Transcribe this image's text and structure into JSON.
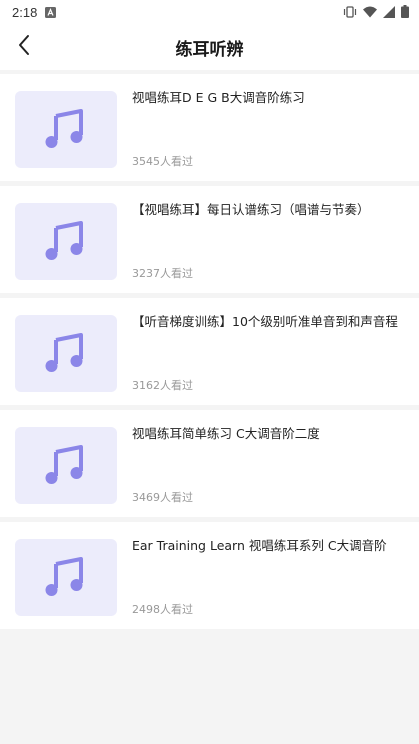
{
  "status_bar": {
    "time": "2:18"
  },
  "header": {
    "title": "练耳听辨"
  },
  "colors": {
    "thumb_bg": "#ececfb",
    "note_icon": "#8b86e8"
  },
  "items": [
    {
      "title": "视唱练耳D E G B大调音阶练习",
      "views": "3545人看过",
      "icon": "music-note-icon"
    },
    {
      "title": "【视唱练耳】每日认谱练习（唱谱与节奏）",
      "views": "3237人看过",
      "icon": "music-note-icon"
    },
    {
      "title": "【听音梯度训练】10个级别听准单音到和声音程",
      "views": "3162人看过",
      "icon": "music-note-icon"
    },
    {
      "title": "视唱练耳简单练习 C大调音阶二度",
      "views": "3469人看过",
      "icon": "music-note-icon"
    },
    {
      "title": "Ear Training Learn 视唱练耳系列 C大调音阶",
      "views": "2498人看过",
      "icon": "music-note-icon"
    }
  ]
}
